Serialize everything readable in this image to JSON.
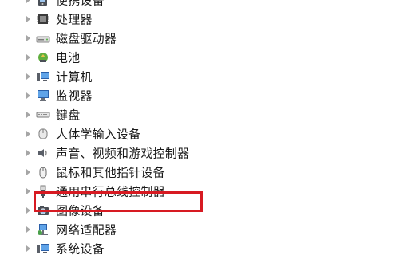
{
  "device_tree": {
    "items": [
      {
        "label": "便携设备",
        "icon": "portable-device-icon"
      },
      {
        "label": "处理器",
        "icon": "processor-icon"
      },
      {
        "label": "磁盘驱动器",
        "icon": "disk-drive-icon"
      },
      {
        "label": "电池",
        "icon": "battery-icon"
      },
      {
        "label": "计算机",
        "icon": "computer-icon"
      },
      {
        "label": "监视器",
        "icon": "monitor-icon"
      },
      {
        "label": "键盘",
        "icon": "keyboard-icon"
      },
      {
        "label": "人体学输入设备",
        "icon": "hid-icon"
      },
      {
        "label": "声音、视频和游戏控制器",
        "icon": "sound-icon"
      },
      {
        "label": "鼠标和其他指针设备",
        "icon": "mouse-icon"
      },
      {
        "label": "通用串行总线控制器",
        "icon": "usb-icon",
        "highlighted": true
      },
      {
        "label": "图像设备",
        "icon": "imaging-device-icon"
      },
      {
        "label": "网络适配器",
        "icon": "network-adapter-icon"
      },
      {
        "label": "系统设备",
        "icon": "system-device-icon"
      }
    ]
  },
  "colors": {
    "highlight_border": "#d71a22",
    "expander": "#a6a6a6",
    "text": "#1a1a1a"
  }
}
